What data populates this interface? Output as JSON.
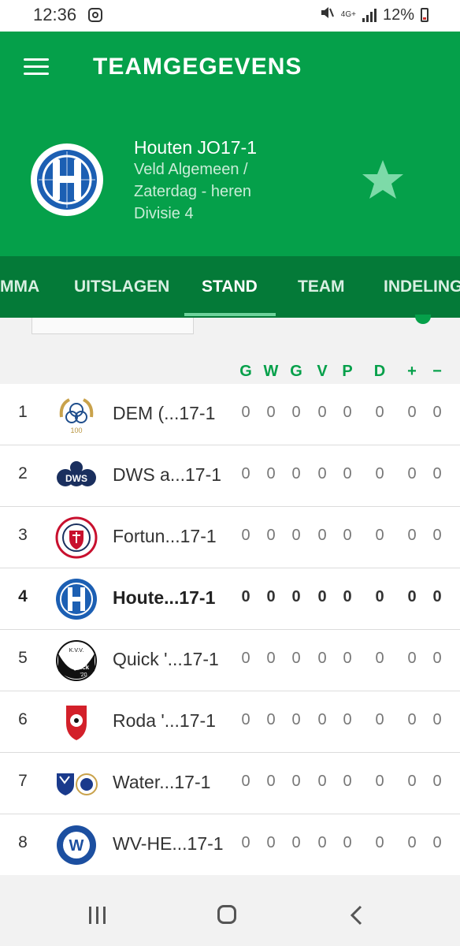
{
  "status_bar": {
    "time": "12:36",
    "network": "4G+",
    "battery": "12%"
  },
  "header": {
    "title": "TEAMGEGEVENS",
    "team_name": "Houten JO17-1",
    "line1": "Veld Algemeen /",
    "line2": "Zaterdag - heren",
    "line3": "Divisie 4",
    "star_color": "#7ddaa8"
  },
  "tabs": [
    {
      "label": "MMA"
    },
    {
      "label": "UITSLAGEN"
    },
    {
      "label": "STAND"
    },
    {
      "label": "TEAM"
    },
    {
      "label": "INDELING"
    }
  ],
  "active_tab": "STAND",
  "columns": [
    "G",
    "W",
    "G",
    "V",
    "P",
    "D",
    "+",
    "−"
  ],
  "rows": [
    {
      "pos": "1",
      "name": "DEM (...17-1",
      "stats": [
        "0",
        "0",
        "0",
        "0",
        "0",
        "0",
        "0",
        "0"
      ],
      "logo": "dem-logo"
    },
    {
      "pos": "2",
      "name": "DWS a...17-1",
      "stats": [
        "0",
        "0",
        "0",
        "0",
        "0",
        "0",
        "0",
        "0"
      ],
      "logo": "dws-logo"
    },
    {
      "pos": "3",
      "name": "Fortun...17-1",
      "stats": [
        "0",
        "0",
        "0",
        "0",
        "0",
        "0",
        "0",
        "0"
      ],
      "logo": "fortuna-logo"
    },
    {
      "pos": "4",
      "name": "Houte...17-1",
      "stats": [
        "0",
        "0",
        "0",
        "0",
        "0",
        "0",
        "0",
        "0"
      ],
      "logo": "houten-logo",
      "highlight": true
    },
    {
      "pos": "5",
      "name": "Quick '...17-1",
      "stats": [
        "0",
        "0",
        "0",
        "0",
        "0",
        "0",
        "0",
        "0"
      ],
      "logo": "quick-logo"
    },
    {
      "pos": "6",
      "name": "Roda '...17-1",
      "stats": [
        "0",
        "0",
        "0",
        "0",
        "0",
        "0",
        "0",
        "0"
      ],
      "logo": "roda-logo"
    },
    {
      "pos": "7",
      "name": "Water...17-1",
      "stats": [
        "0",
        "0",
        "0",
        "0",
        "0",
        "0",
        "0",
        "0"
      ],
      "logo": "water-logo"
    },
    {
      "pos": "8",
      "name": "WV-HE...17-1",
      "stats": [
        "0",
        "0",
        "0",
        "0",
        "0",
        "0",
        "0",
        "0"
      ],
      "logo": "wvhedw-logo"
    }
  ],
  "logo_texts": {
    "dem_number": "100",
    "dws": "DWS",
    "quick_top": "K.V.V.",
    "quick_name": "Quick",
    "quick_year": "'20",
    "wv": "W"
  },
  "colors": {
    "primary": "#05a04a",
    "tabs_bg": "#047a38",
    "houten_blue": "#1c5fb3"
  }
}
